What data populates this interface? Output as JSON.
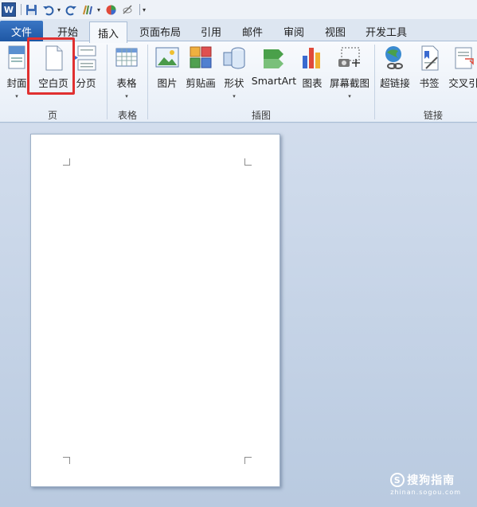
{
  "quick_access": {
    "app_icon": "word-icon",
    "app_letter": "W",
    "items": [
      "save-icon",
      "undo-icon",
      "redo-icon",
      "format-painter-icon",
      "color-icon",
      "eraser-icon"
    ]
  },
  "tabs": [
    {
      "label": "文件"
    },
    {
      "label": "开始"
    },
    {
      "label": "插入"
    },
    {
      "label": "页面布局"
    },
    {
      "label": "引用"
    },
    {
      "label": "邮件"
    },
    {
      "label": "审阅"
    },
    {
      "label": "视图"
    },
    {
      "label": "开发工具"
    }
  ],
  "active_tab": "插入",
  "ribbon": {
    "pages_group": {
      "label": "页",
      "buttons": [
        {
          "label": "封面",
          "icon": "cover-page-icon",
          "dropdown": "▾"
        },
        {
          "label": "空白页",
          "icon": "blank-page-icon"
        },
        {
          "label": "分页",
          "icon": "page-break-icon"
        }
      ]
    },
    "tables_group": {
      "label": "表格",
      "buttons": [
        {
          "label": "表格",
          "icon": "table-icon",
          "dropdown": "▾"
        }
      ]
    },
    "illustrations_group": {
      "label": "插图",
      "buttons": [
        {
          "label": "图片",
          "icon": "picture-icon"
        },
        {
          "label": "剪贴画",
          "icon": "clip-art-icon"
        },
        {
          "label": "形状",
          "icon": "shapes-icon",
          "dropdown": "▾"
        },
        {
          "label": "SmartArt",
          "icon": "smartart-icon"
        },
        {
          "label": "图表",
          "icon": "chart-icon"
        },
        {
          "label": "屏幕截图",
          "icon": "screenshot-icon",
          "dropdown": "▾"
        }
      ]
    },
    "links_group": {
      "label": "链接",
      "buttons": [
        {
          "label": "超链接",
          "icon": "hyperlink-icon"
        },
        {
          "label": "书签",
          "icon": "bookmark-icon"
        },
        {
          "label": "交叉引",
          "icon": "cross-reference-icon"
        }
      ]
    }
  },
  "watermark": {
    "main": "搜狗指南",
    "circle": "S",
    "sub": "zhinan.sogou.com"
  },
  "colors": {
    "accent": "#2b579a",
    "file_tab": "#2a66b5",
    "highlight": "#e03030"
  }
}
